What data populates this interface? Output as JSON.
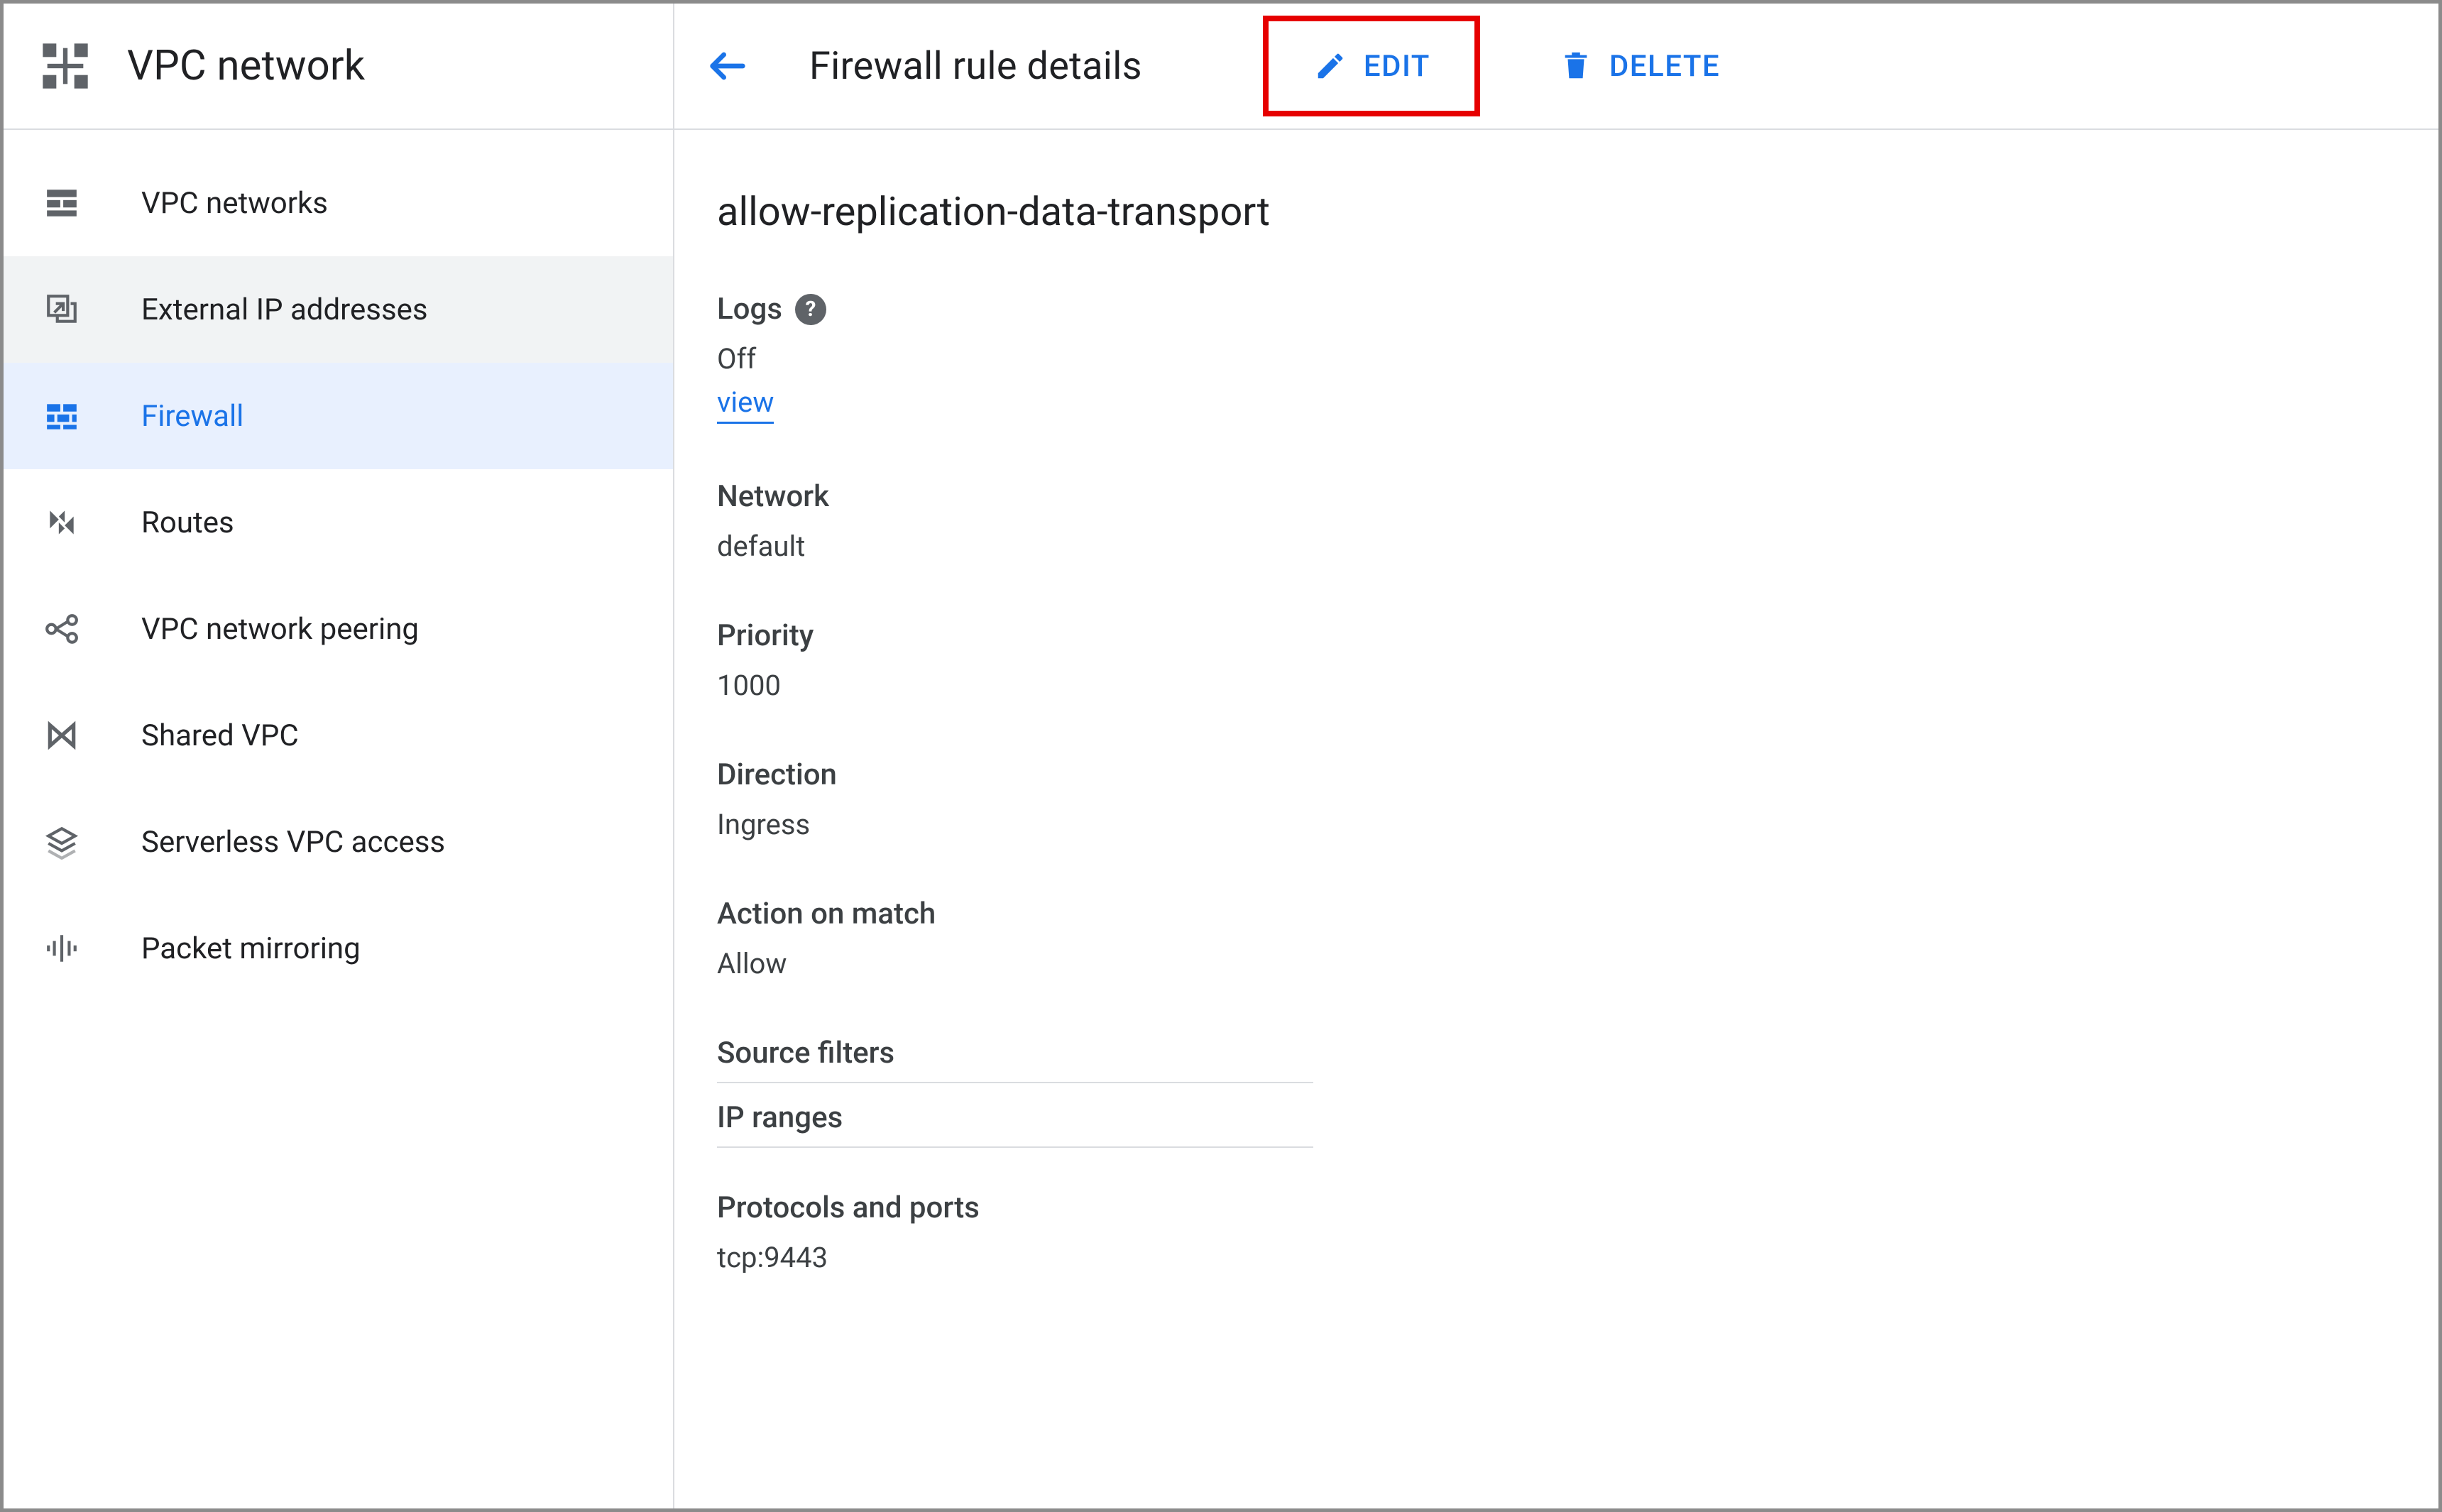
{
  "sidebar": {
    "title": "VPC network",
    "items": [
      {
        "label": "VPC networks",
        "icon": "vpc-networks-icon",
        "state": "normal"
      },
      {
        "label": "External IP addresses",
        "icon": "external-ip-icon",
        "state": "hover"
      },
      {
        "label": "Firewall",
        "icon": "firewall-icon",
        "state": "selected"
      },
      {
        "label": "Routes",
        "icon": "routes-icon",
        "state": "normal"
      },
      {
        "label": "VPC network peering",
        "icon": "peering-icon",
        "state": "normal"
      },
      {
        "label": "Shared VPC",
        "icon": "shared-vpc-icon",
        "state": "normal"
      },
      {
        "label": "Serverless VPC access",
        "icon": "serverless-vpc-icon",
        "state": "normal"
      },
      {
        "label": "Packet mirroring",
        "icon": "packet-mirroring-icon",
        "state": "normal"
      }
    ]
  },
  "header": {
    "page_title": "Firewall rule details",
    "edit_label": "EDIT",
    "delete_label": "DELETE"
  },
  "rule": {
    "name": "allow-replication-data-transport",
    "logs": {
      "label": "Logs",
      "value": "Off",
      "view_link": "view"
    },
    "network": {
      "label": "Network",
      "value": "default"
    },
    "priority": {
      "label": "Priority",
      "value": "1000"
    },
    "direction": {
      "label": "Direction",
      "value": "Ingress"
    },
    "action": {
      "label": "Action on match",
      "value": "Allow"
    },
    "source_filters": {
      "label": "Source filters",
      "row": "IP ranges"
    },
    "protocols": {
      "label": "Protocols and ports",
      "value": "tcp:9443"
    }
  }
}
